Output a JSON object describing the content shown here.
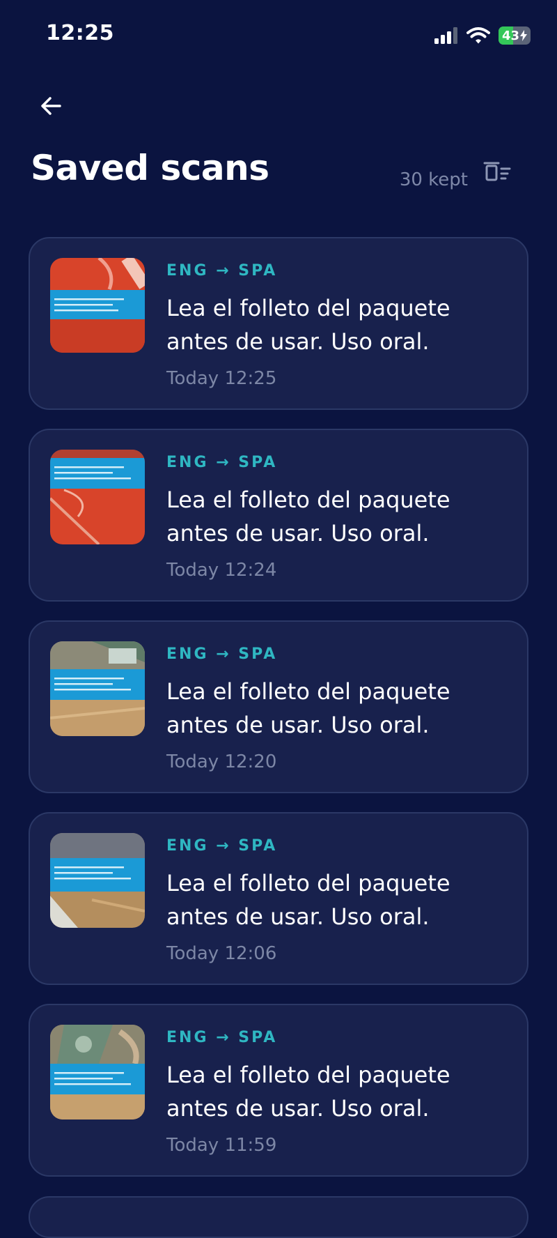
{
  "status": {
    "time": "12:25",
    "battery": "43"
  },
  "header": {
    "title": "Saved scans",
    "kept": "30 kept"
  },
  "icons": {
    "back": "arrow-left-icon",
    "clear": "clear-all-icon"
  },
  "colors": {
    "background": "#0b1440",
    "card": "#18214d",
    "accent": "#2fb7c2"
  },
  "scans": [
    {
      "langs": "ENG → SPA",
      "text": "Lea el folleto del paquete antes de usar. Uso oral.",
      "time": "Today 12:25"
    },
    {
      "langs": "ENG → SPA",
      "text": "Lea el folleto del paquete antes de usar. Uso oral.",
      "time": "Today 12:24"
    },
    {
      "langs": "ENG → SPA",
      "text": "Lea el folleto del paquete antes de usar. Uso oral.",
      "time": "Today 12:20"
    },
    {
      "langs": "ENG → SPA",
      "text": "Lea el folleto del paquete antes de usar. Uso oral.",
      "time": "Today 12:06"
    },
    {
      "langs": "ENG → SPA",
      "text": "Lea el folleto del paquete antes de usar. Uso oral.",
      "time": "Today 11:59"
    }
  ]
}
